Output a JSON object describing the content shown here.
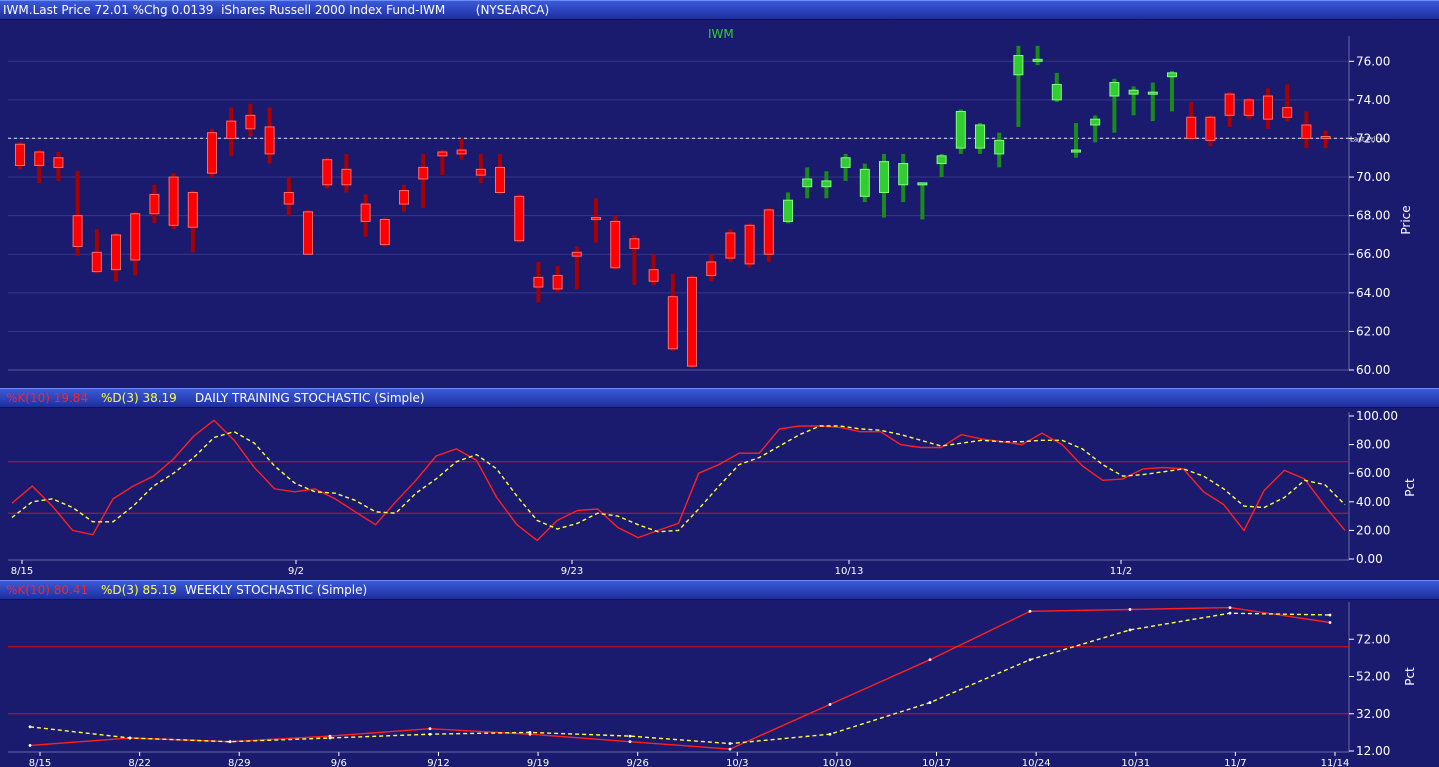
{
  "header": {
    "title": "IWM.Last Price 72.01 %Chg 0.0139  iShares Russell 2000 Index Fund-IWM        (NYSEARCA)"
  },
  "colors": {
    "background": "#1a1a6e",
    "up": "#33cc33",
    "down": "#ff0000",
    "k_line": "#ff2020",
    "d_line": "#ffff40",
    "axis_text": "#ffffff",
    "symbol": "#33cc33"
  },
  "chart_data": [
    {
      "type": "candlestick",
      "symbol_label": "IWM",
      "ylabel": "Price",
      "ylim": [
        60,
        77
      ],
      "yticks": [
        "60.00",
        "62.00",
        "64.00",
        "66.00",
        "68.00",
        "70.00",
        "72.00",
        "74.00",
        "76.00"
      ],
      "last_price": 72.01,
      "last_price_label": "Last Price",
      "candles": [
        {
          "o": 71.7,
          "h": 71.8,
          "l": 70.4,
          "c": 70.6,
          "dir": "down"
        },
        {
          "o": 71.3,
          "h": 71.4,
          "l": 69.7,
          "c": 70.6,
          "dir": "down"
        },
        {
          "o": 71.0,
          "h": 71.3,
          "l": 69.8,
          "c": 70.5,
          "dir": "down"
        },
        {
          "o": 68.0,
          "h": 70.3,
          "l": 65.9,
          "c": 66.4,
          "dir": "down"
        },
        {
          "o": 66.1,
          "h": 67.3,
          "l": 65.0,
          "c": 65.1,
          "dir": "down"
        },
        {
          "o": 67.0,
          "h": 67.1,
          "l": 64.6,
          "c": 65.2,
          "dir": "down"
        },
        {
          "o": 68.1,
          "h": 68.2,
          "l": 64.9,
          "c": 65.7,
          "dir": "down"
        },
        {
          "o": 69.1,
          "h": 69.6,
          "l": 67.6,
          "c": 68.1,
          "dir": "down"
        },
        {
          "o": 70.0,
          "h": 70.2,
          "l": 67.3,
          "c": 67.5,
          "dir": "down"
        },
        {
          "o": 69.2,
          "h": 69.3,
          "l": 66.1,
          "c": 67.4,
          "dir": "down"
        },
        {
          "o": 72.3,
          "h": 72.5,
          "l": 70.0,
          "c": 70.2,
          "dir": "down"
        },
        {
          "o": 72.9,
          "h": 73.6,
          "l": 71.1,
          "c": 72.0,
          "dir": "down"
        },
        {
          "o": 73.2,
          "h": 73.8,
          "l": 72.1,
          "c": 72.5,
          "dir": "down"
        },
        {
          "o": 72.6,
          "h": 73.6,
          "l": 70.7,
          "c": 71.2,
          "dir": "down"
        },
        {
          "o": 69.2,
          "h": 70.0,
          "l": 68.0,
          "c": 68.6,
          "dir": "down"
        },
        {
          "o": 68.2,
          "h": 68.3,
          "l": 66.0,
          "c": 66.0,
          "dir": "down"
        },
        {
          "o": 70.9,
          "h": 71.0,
          "l": 69.4,
          "c": 69.6,
          "dir": "down"
        },
        {
          "o": 70.4,
          "h": 71.2,
          "l": 69.2,
          "c": 69.6,
          "dir": "down"
        },
        {
          "o": 68.6,
          "h": 69.1,
          "l": 66.9,
          "c": 67.7,
          "dir": "down"
        },
        {
          "o": 67.8,
          "h": 67.9,
          "l": 66.4,
          "c": 66.5,
          "dir": "down"
        },
        {
          "o": 69.3,
          "h": 69.6,
          "l": 68.2,
          "c": 68.6,
          "dir": "down"
        },
        {
          "o": 70.5,
          "h": 71.2,
          "l": 68.4,
          "c": 69.9,
          "dir": "down"
        },
        {
          "o": 71.3,
          "h": 71.4,
          "l": 70.1,
          "c": 71.1,
          "dir": "down"
        },
        {
          "o": 71.4,
          "h": 72.0,
          "l": 70.9,
          "c": 71.2,
          "dir": "down"
        },
        {
          "o": 70.4,
          "h": 71.2,
          "l": 69.7,
          "c": 70.1,
          "dir": "down"
        },
        {
          "o": 70.5,
          "h": 71.2,
          "l": 69.1,
          "c": 69.2,
          "dir": "down"
        },
        {
          "o": 69.0,
          "h": 69.1,
          "l": 66.6,
          "c": 66.7,
          "dir": "down"
        },
        {
          "o": 64.8,
          "h": 65.6,
          "l": 63.5,
          "c": 64.3,
          "dir": "down"
        },
        {
          "o": 64.9,
          "h": 65.4,
          "l": 64.0,
          "c": 64.2,
          "dir": "down"
        },
        {
          "o": 66.1,
          "h": 66.4,
          "l": 64.2,
          "c": 65.9,
          "dir": "down"
        },
        {
          "o": 67.9,
          "h": 68.9,
          "l": 66.6,
          "c": 67.9,
          "dir": "down"
        },
        {
          "o": 67.7,
          "h": 68.0,
          "l": 65.2,
          "c": 65.3,
          "dir": "down"
        },
        {
          "o": 66.8,
          "h": 67.0,
          "l": 64.4,
          "c": 66.3,
          "dir": "down"
        },
        {
          "o": 65.2,
          "h": 66.0,
          "l": 64.4,
          "c": 64.6,
          "dir": "down"
        },
        {
          "o": 63.8,
          "h": 65.0,
          "l": 61.0,
          "c": 61.1,
          "dir": "down"
        },
        {
          "o": 64.8,
          "h": 64.9,
          "l": 60.1,
          "c": 60.2,
          "dir": "down"
        },
        {
          "o": 65.6,
          "h": 66.0,
          "l": 64.6,
          "c": 64.9,
          "dir": "down"
        },
        {
          "o": 67.1,
          "h": 67.3,
          "l": 65.6,
          "c": 65.8,
          "dir": "down"
        },
        {
          "o": 67.5,
          "h": 67.6,
          "l": 65.3,
          "c": 65.5,
          "dir": "down"
        },
        {
          "o": 68.3,
          "h": 68.4,
          "l": 65.6,
          "c": 66.0,
          "dir": "down"
        },
        {
          "o": 67.7,
          "h": 69.2,
          "l": 67.6,
          "c": 68.8,
          "dir": "up"
        },
        {
          "o": 69.5,
          "h": 70.5,
          "l": 68.9,
          "c": 69.9,
          "dir": "up"
        },
        {
          "o": 69.5,
          "h": 70.3,
          "l": 68.9,
          "c": 69.8,
          "dir": "up"
        },
        {
          "o": 70.5,
          "h": 71.2,
          "l": 69.8,
          "c": 71.0,
          "dir": "up"
        },
        {
          "o": 69.0,
          "h": 70.7,
          "l": 68.7,
          "c": 70.4,
          "dir": "up"
        },
        {
          "o": 69.2,
          "h": 71.2,
          "l": 67.9,
          "c": 70.8,
          "dir": "up"
        },
        {
          "o": 69.6,
          "h": 71.2,
          "l": 68.7,
          "c": 70.7,
          "dir": "up"
        },
        {
          "o": 69.6,
          "h": 69.7,
          "l": 67.8,
          "c": 69.7,
          "dir": "up"
        },
        {
          "o": 70.7,
          "h": 71.2,
          "l": 70.0,
          "c": 71.1,
          "dir": "up"
        },
        {
          "o": 71.5,
          "h": 73.5,
          "l": 71.2,
          "c": 73.4,
          "dir": "up"
        },
        {
          "o": 71.5,
          "h": 72.8,
          "l": 71.2,
          "c": 72.7,
          "dir": "up"
        },
        {
          "o": 71.2,
          "h": 72.3,
          "l": 70.5,
          "c": 71.9,
          "dir": "up"
        },
        {
          "o": 75.3,
          "h": 76.8,
          "l": 72.6,
          "c": 76.3,
          "dir": "up"
        },
        {
          "o": 76.0,
          "h": 76.8,
          "l": 75.8,
          "c": 76.1,
          "dir": "up"
        },
        {
          "o": 74.0,
          "h": 75.4,
          "l": 73.9,
          "c": 74.8,
          "dir": "up"
        },
        {
          "o": 71.3,
          "h": 72.8,
          "l": 71.0,
          "c": 71.4,
          "dir": "up"
        },
        {
          "o": 72.7,
          "h": 73.2,
          "l": 71.8,
          "c": 73.0,
          "dir": "up"
        },
        {
          "o": 74.2,
          "h": 75.1,
          "l": 72.3,
          "c": 74.9,
          "dir": "up"
        },
        {
          "o": 74.3,
          "h": 74.7,
          "l": 73.2,
          "c": 74.5,
          "dir": "up"
        },
        {
          "o": 74.4,
          "h": 74.9,
          "l": 72.9,
          "c": 74.4,
          "dir": "up"
        },
        {
          "o": 75.2,
          "h": 75.5,
          "l": 73.4,
          "c": 75.4,
          "dir": "up"
        },
        {
          "o": 73.1,
          "h": 73.9,
          "l": 71.9,
          "c": 72.0,
          "dir": "down"
        },
        {
          "o": 73.1,
          "h": 73.2,
          "l": 71.6,
          "c": 71.9,
          "dir": "down"
        },
        {
          "o": 74.3,
          "h": 74.4,
          "l": 72.6,
          "c": 73.2,
          "dir": "down"
        },
        {
          "o": 74.0,
          "h": 74.1,
          "l": 73.0,
          "c": 73.2,
          "dir": "down"
        },
        {
          "o": 74.2,
          "h": 74.6,
          "l": 72.5,
          "c": 73.0,
          "dir": "down"
        },
        {
          "o": 73.6,
          "h": 74.8,
          "l": 72.9,
          "c": 73.1,
          "dir": "down"
        },
        {
          "o": 72.7,
          "h": 73.4,
          "l": 71.5,
          "c": 72.0,
          "dir": "down"
        },
        {
          "o": 72.1,
          "h": 72.4,
          "l": 71.5,
          "c": 72.0,
          "dir": "down"
        }
      ]
    },
    {
      "type": "line",
      "title": "DAILY TRAINING STOCHASTIC (Simple)",
      "k_label": "%K(10) 19.84",
      "d_label": "%D(3) 38.19",
      "ylabel": "Pct",
      "ylim": [
        0,
        100
      ],
      "yticks": [
        "0.00",
        "20.00",
        "40.00",
        "60.00",
        "80.00",
        "100.00"
      ],
      "reference_lines": [
        68,
        32
      ],
      "x_tick_labels": [
        "8/15",
        "9/2",
        "9/23",
        "10/13",
        "11/2"
      ],
      "series": [
        {
          "name": "%K(10)",
          "values": [
            39,
            51,
            37,
            20,
            17,
            42,
            51,
            58,
            70,
            86,
            97,
            83,
            64,
            49,
            47,
            49,
            42,
            33,
            24,
            40,
            55,
            72,
            77,
            69,
            43,
            24,
            13,
            27,
            34,
            35,
            22,
            15,
            20,
            25,
            60,
            66,
            74,
            74,
            91,
            93,
            93,
            92,
            89,
            89,
            80,
            78,
            78,
            87,
            84,
            82,
            80,
            88,
            80,
            65,
            55,
            56,
            63,
            64,
            63,
            47,
            38,
            20,
            48,
            62,
            56,
            37,
            20
          ],
          "style": "solid"
        },
        {
          "name": "%D(3)",
          "values": [
            29,
            40,
            42,
            36,
            26,
            26,
            37,
            51,
            60,
            71,
            85,
            89,
            81,
            65,
            53,
            47,
            46,
            41,
            33,
            32,
            46,
            56,
            68,
            73,
            63,
            44,
            27,
            21,
            25,
            32,
            30,
            24,
            19,
            20,
            35,
            51,
            66,
            71,
            79,
            87,
            93,
            93,
            91,
            90,
            87,
            83,
            79,
            81,
            83,
            82,
            82,
            83,
            83,
            77,
            66,
            58,
            59,
            61,
            63,
            58,
            49,
            37,
            36,
            43,
            55,
            52,
            38
          ],
          "style": "dashed"
        }
      ]
    },
    {
      "type": "line",
      "title": "WEEKLY STOCHASTIC (Simple)",
      "k_label": "%K(10) 80.41",
      "d_label": "%D(3) 85.19",
      "ylabel": "Pct",
      "ylim": [
        12,
        92
      ],
      "yticks": [
        "12.00",
        "32.00",
        "52.00",
        "72.00"
      ],
      "reference_lines": [
        68,
        32
      ],
      "x_tick_labels": [
        "8/15",
        "8/22",
        "8/29",
        "9/6",
        "9/12",
        "9/19",
        "9/26",
        "10/3",
        "10/10",
        "10/17",
        "10/24",
        "10/31",
        "11/7",
        "11/14"
      ],
      "series": [
        {
          "name": "%K(10)",
          "values": [
            15,
            19,
            17,
            20,
            24,
            21,
            17,
            13,
            37,
            61,
            87,
            88,
            89,
            81
          ],
          "style": "solid"
        },
        {
          "name": "%D(3)",
          "values": [
            25,
            19,
            17,
            19,
            21,
            22,
            20,
            16,
            21,
            38,
            61,
            77,
            86,
            85
          ],
          "style": "dashed"
        }
      ]
    }
  ]
}
